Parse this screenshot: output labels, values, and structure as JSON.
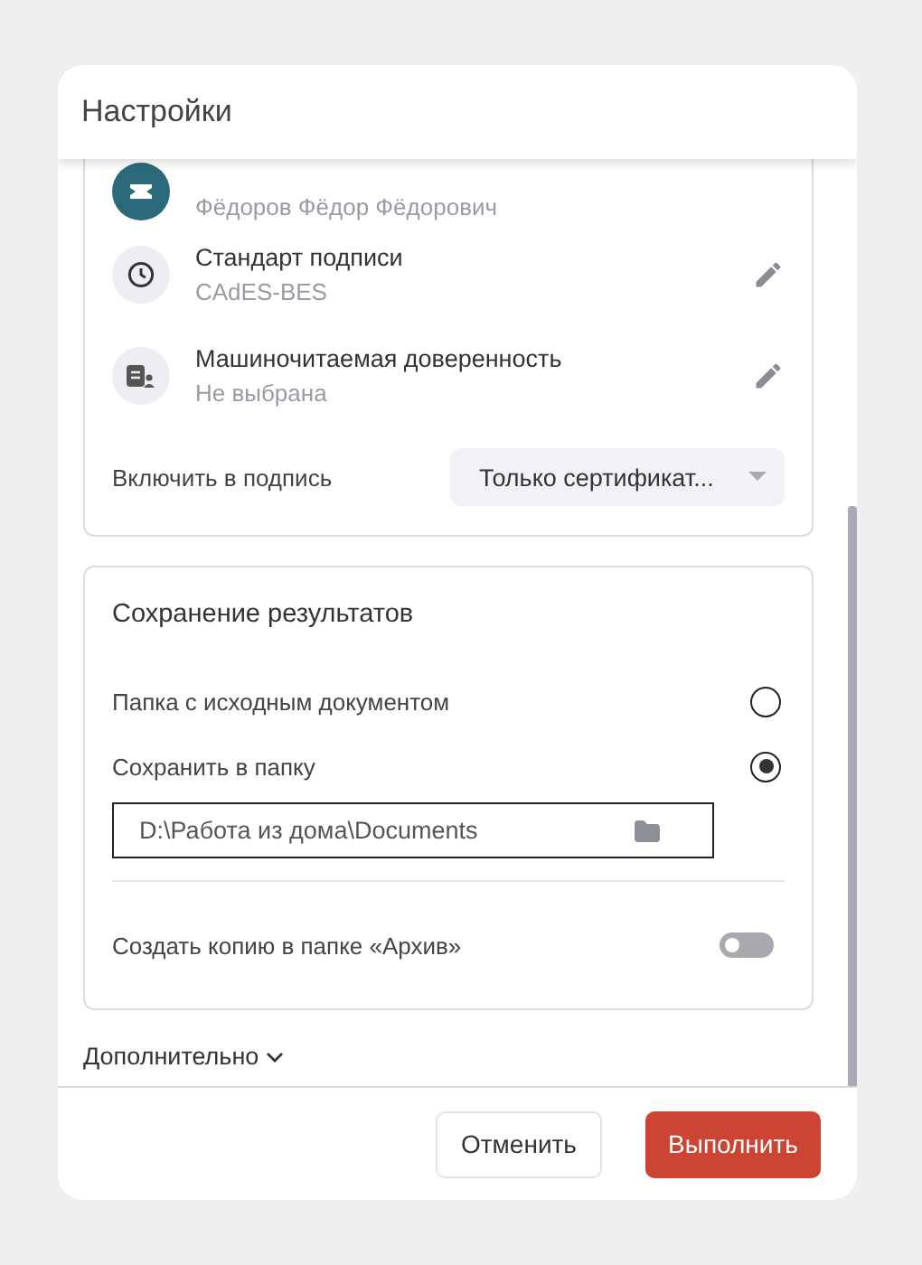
{
  "dialog": {
    "title": "Настройки"
  },
  "signature_card": {
    "rows": [
      {
        "kind": "avatar",
        "title": "",
        "value": "Фёдоров Фёдор Фёдорович"
      },
      {
        "kind": "clock",
        "title": "Стандарт подписи",
        "value": "CAdES-BES"
      },
      {
        "kind": "document",
        "title": "Машиночитаемая доверенность",
        "value": "Не выбрана"
      }
    ],
    "include": {
      "label": "Включить в подпись",
      "value": "Только сертификат..."
    }
  },
  "save_card": {
    "title": "Сохранение результатов",
    "options": [
      {
        "label": "Папка с исходным документом",
        "selected": false
      },
      {
        "label": "Сохранить в папку",
        "selected": true
      }
    ],
    "folder": {
      "value": "D:\\Работа из дома\\Documents"
    },
    "archive_copy": {
      "label": "Создать копию в папке «Архив»",
      "on": false
    }
  },
  "more": {
    "label": "Дополнительно",
    "expanded": false
  },
  "buttons": [
    {
      "label": "Отменить",
      "kind": "secondary"
    },
    {
      "label": "Выполнить",
      "kind": "primary"
    }
  ]
}
